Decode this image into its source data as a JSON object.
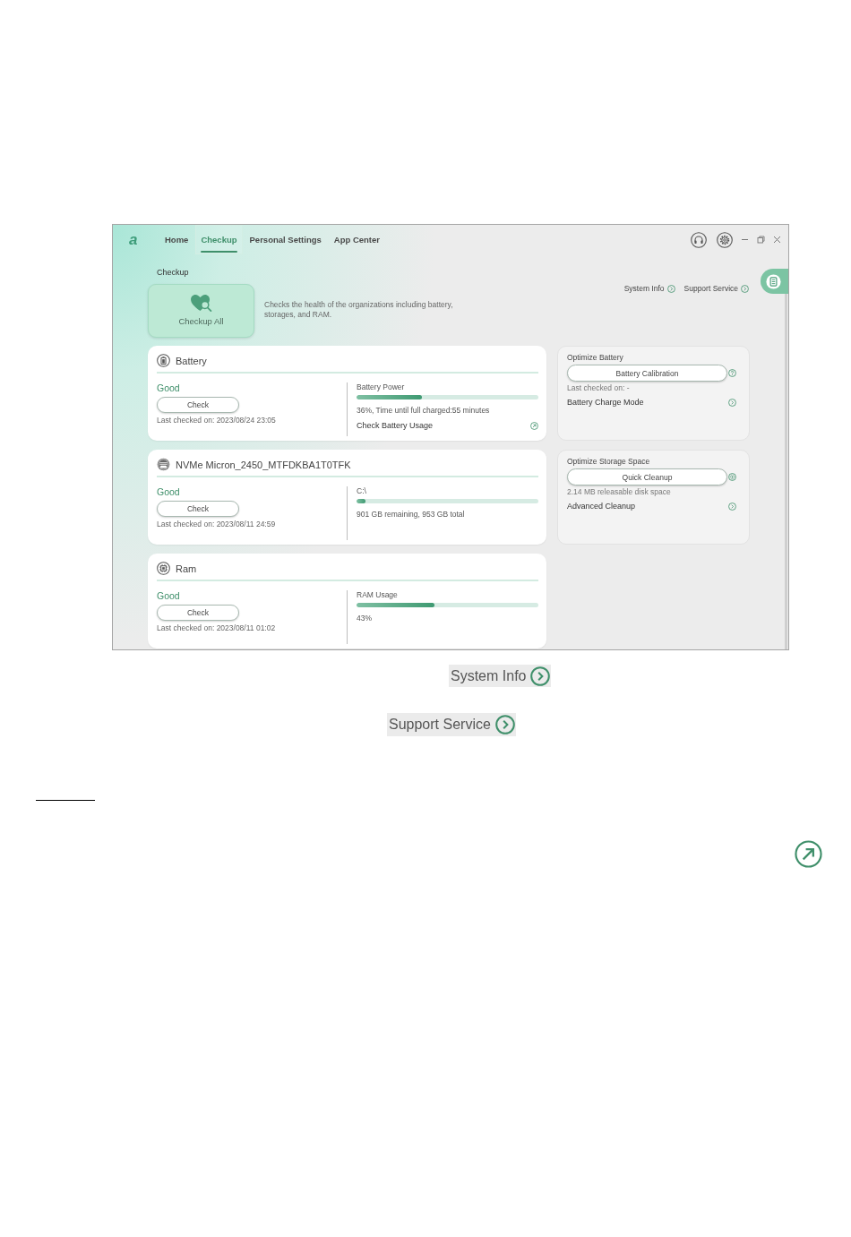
{
  "app": {
    "logo": "a",
    "nav": [
      {
        "label": "Home",
        "selected": false
      },
      {
        "label": "Checkup",
        "selected": true
      },
      {
        "label": "Personal Settings",
        "selected": false
      },
      {
        "label": "App Center",
        "selected": false
      }
    ],
    "section_title": "Checkup",
    "checkup_all": {
      "label": "Checkup All"
    },
    "description": "Checks the health of the organizations including battery, storages, and RAM.",
    "links": [
      "System Info",
      "Support Service"
    ],
    "devices": [
      {
        "kind": "battery",
        "name": "Battery",
        "status": "Good",
        "button": "Check",
        "last_checked": "Last checked on: 2023/08/24 23:05",
        "meter_label": "Battery Power",
        "level": 0.36,
        "reading": "36%, Time until full charged:55 minutes",
        "link": "Check Battery Usage"
      },
      {
        "kind": "storage",
        "name": "NVMe Micron_2450_MTFDKBA1T0TFK",
        "status": "Good",
        "button": "Check",
        "last_checked": "Last checked on: 2023/08/11 24:59",
        "meter_label": "C:\\",
        "level": 0.05,
        "reading": "901 GB remaining, 953 GB total"
      },
      {
        "kind": "ram",
        "name": "Ram",
        "status": "Good",
        "button": "Check",
        "last_checked": "Last checked on: 2023/08/11 01:02",
        "meter_label": "RAM Usage",
        "level": 0.43,
        "reading": "43%"
      }
    ],
    "optimize": [
      {
        "kind": "battery",
        "title": "Optimize Battery",
        "button": "Battery Calibration",
        "note": "Last checked on: -",
        "link": "Battery Charge Mode"
      },
      {
        "kind": "storage",
        "title": "Optimize Storage Space",
        "button": "Quick Cleanup",
        "note": "2.14 MB releasable disk space",
        "link": "Advanced Cleanup"
      }
    ]
  },
  "callouts": [
    {
      "label": "System Info"
    },
    {
      "label": "Support Service"
    }
  ]
}
